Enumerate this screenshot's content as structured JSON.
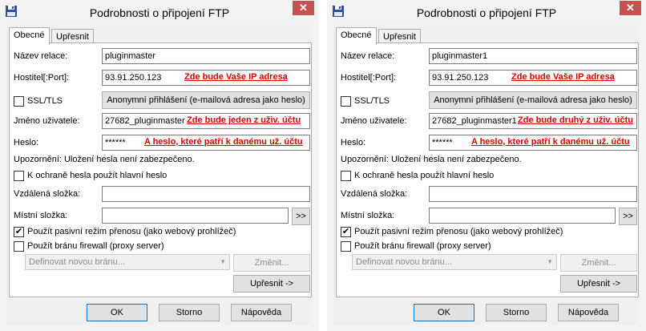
{
  "windows": [
    {
      "title": "Podrobnosti o připojení FTP",
      "close_glyph": "✕",
      "tabs": [
        "Obecné",
        "Upřesnit"
      ],
      "session_name_label": "Název relace:",
      "session_name_value": "pluginmaster",
      "host_label": "Hostitel[:Port]:",
      "host_value": "93.91.250.123",
      "host_note": "Zde bude Vaše IP adresa",
      "ssl_label": "SSL/TLS",
      "ssl_checked": false,
      "anon_button": "Anonymní přihlášení (e-mailová adresa jako heslo)",
      "username_label": "Jméno uživatele:",
      "username_value": "27682_pluginmaster",
      "username_note": "Zde bude jeden z uživ. účtu",
      "password_label": "Heslo:",
      "password_value": "******",
      "password_note": "A heslo, které patří k danému už. účtu",
      "warning": "Upozornění: Uložení hesla není zabezpečeno.",
      "master_pw_label": "K ochraně hesla použít hlavní heslo",
      "master_pw_checked": false,
      "remote_folder_label": "Vzdálená složka:",
      "remote_folder_value": "",
      "local_folder_label": "Místní složka:",
      "local_folder_value": "",
      "browse_button": ">>",
      "passive_label": "Použít pasivní režim přenosu (jako webový prohlížeč)",
      "passive_checked": true,
      "firewall_label": "Použít bránu firewall (proxy server)",
      "firewall_checked": false,
      "firewall_select": "Definovat novou bránu...",
      "change_button": "Změnit...",
      "advanced_button": "Upřesnit ->",
      "ok_button": "OK",
      "cancel_button": "Storno",
      "help_button": "Nápověda"
    },
    {
      "title": "Podrobnosti o připojení FTP",
      "close_glyph": "✕",
      "tabs": [
        "Obecné",
        "Upřesnit"
      ],
      "session_name_label": "Název relace:",
      "session_name_value": "pluginmaster1",
      "host_label": "Hostitel[:Port]:",
      "host_value": "93.91.250.123",
      "host_note": "Zde bude Vaše IP adresa",
      "ssl_label": "SSL/TLS",
      "ssl_checked": false,
      "anon_button": "Anonymní přihlášení (e-mailová adresa jako heslo)",
      "username_label": "Jméno uživatele:",
      "username_value": "27682_pluginmaster1",
      "username_note": "Zde bude druhý z uživ. účtu",
      "password_label": "Heslo:",
      "password_value": "******",
      "password_note": "A heslo, které patří k danému už. účtu",
      "warning": "Upozornění: Uložení hesla není zabezpečeno.",
      "master_pw_label": "K ochraně hesla použít hlavní heslo",
      "master_pw_checked": false,
      "remote_folder_label": "Vzdálená složka:",
      "remote_folder_value": "",
      "local_folder_label": "Místní složka:",
      "local_folder_value": "",
      "browse_button": ">>",
      "passive_label": "Použít pasivní režim přenosu (jako webový prohlížeč)",
      "passive_checked": true,
      "firewall_label": "Použít bránu firewall (proxy server)",
      "firewall_checked": false,
      "firewall_select": "Definovat novou bránu...",
      "change_button": "Změnit...",
      "advanced_button": "Upřesnit ->",
      "ok_button": "OK",
      "cancel_button": "Storno",
      "help_button": "Nápověda"
    }
  ]
}
